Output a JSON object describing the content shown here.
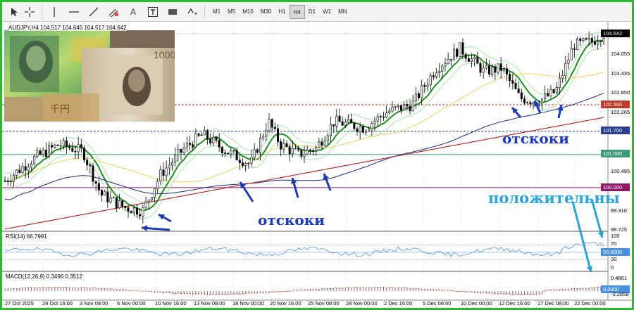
{
  "toolbar": {
    "tools": [
      {
        "name": "cursor-icon"
      },
      {
        "name": "crosshair-icon"
      },
      {
        "name": "vertical-line-icon"
      },
      {
        "name": "horizontal-line-icon"
      },
      {
        "name": "trendline-icon"
      },
      {
        "name": "channel-icon"
      },
      {
        "name": "text-icon",
        "label": "A"
      },
      {
        "name": "text-label-icon",
        "label": "T"
      },
      {
        "name": "rectangle-icon"
      },
      {
        "name": "shapes-dropdown-icon"
      }
    ],
    "timeframes": [
      "M1",
      "M5",
      "M15",
      "M30",
      "H1",
      "H4",
      "D1",
      "W1",
      "MN"
    ],
    "active_timeframe": "H4"
  },
  "chart": {
    "header": "AUDJPY,H4  104.517 104.645 104.517 104.642",
    "rsi_label": "RSI(14) 66.7991",
    "macd_label": "MACD(12,26,9) 0.3496 0.3512",
    "current_price": "104.642",
    "price_levels": [
      {
        "label": "102.500",
        "color": "#c0392b",
        "value": 102.5
      },
      {
        "label": "101.700",
        "color": "#2c3e8f",
        "value": 101.7
      },
      {
        "label": "101.000",
        "color": "#3a9a7a",
        "value": 101.0
      },
      {
        "label": "100.000",
        "color": "#8b1a6b",
        "value": 100.0
      }
    ],
    "y_axis_labels": [
      "104.642",
      "104.055",
      "103.435",
      "102.850",
      "102.265",
      "101.680",
      "101.060",
      "100.495",
      "99.310",
      "98.725"
    ],
    "rsi_axis_labels": [
      "100",
      "70",
      "50.0000",
      "30",
      "0"
    ],
    "macd_axis_labels": [
      "0.4861",
      "0.0000",
      "-0.2858"
    ],
    "x_axis_labels": [
      "27 Oct 2025",
      "29 Oct 16:00",
      "3 Nov 08:00",
      "6 Nov 00:00",
      "10 Nov 16:00",
      "13 Nov 08:00",
      "18 Nov 00:00",
      "20 Nov 16:00",
      "25 Nov 08:00",
      "28 Nov 00:00",
      "2 Dec 16:00",
      "5 Dec 08:00",
      "10 Dec 00:00",
      "12 Dec 16:00",
      "17 Dec 08:00",
      "22 Dec 00:00"
    ],
    "colors": {
      "fast_ma": "#1f8f1f",
      "slow_ma_yellow": "#f0d060",
      "ma_blue": "#1a2a8a",
      "ma_red": "#b02020",
      "bb": "#a8e6a8",
      "frame": "#2fb82f",
      "rsi_line": "#4a90e2",
      "annotation_blue": "#1a3ab8",
      "annotation_cyan": "#2aa3d8"
    }
  },
  "annotations": {
    "rebound_1": "отскоки",
    "rebound_2": "отскоки",
    "positive": "положительны"
  }
}
